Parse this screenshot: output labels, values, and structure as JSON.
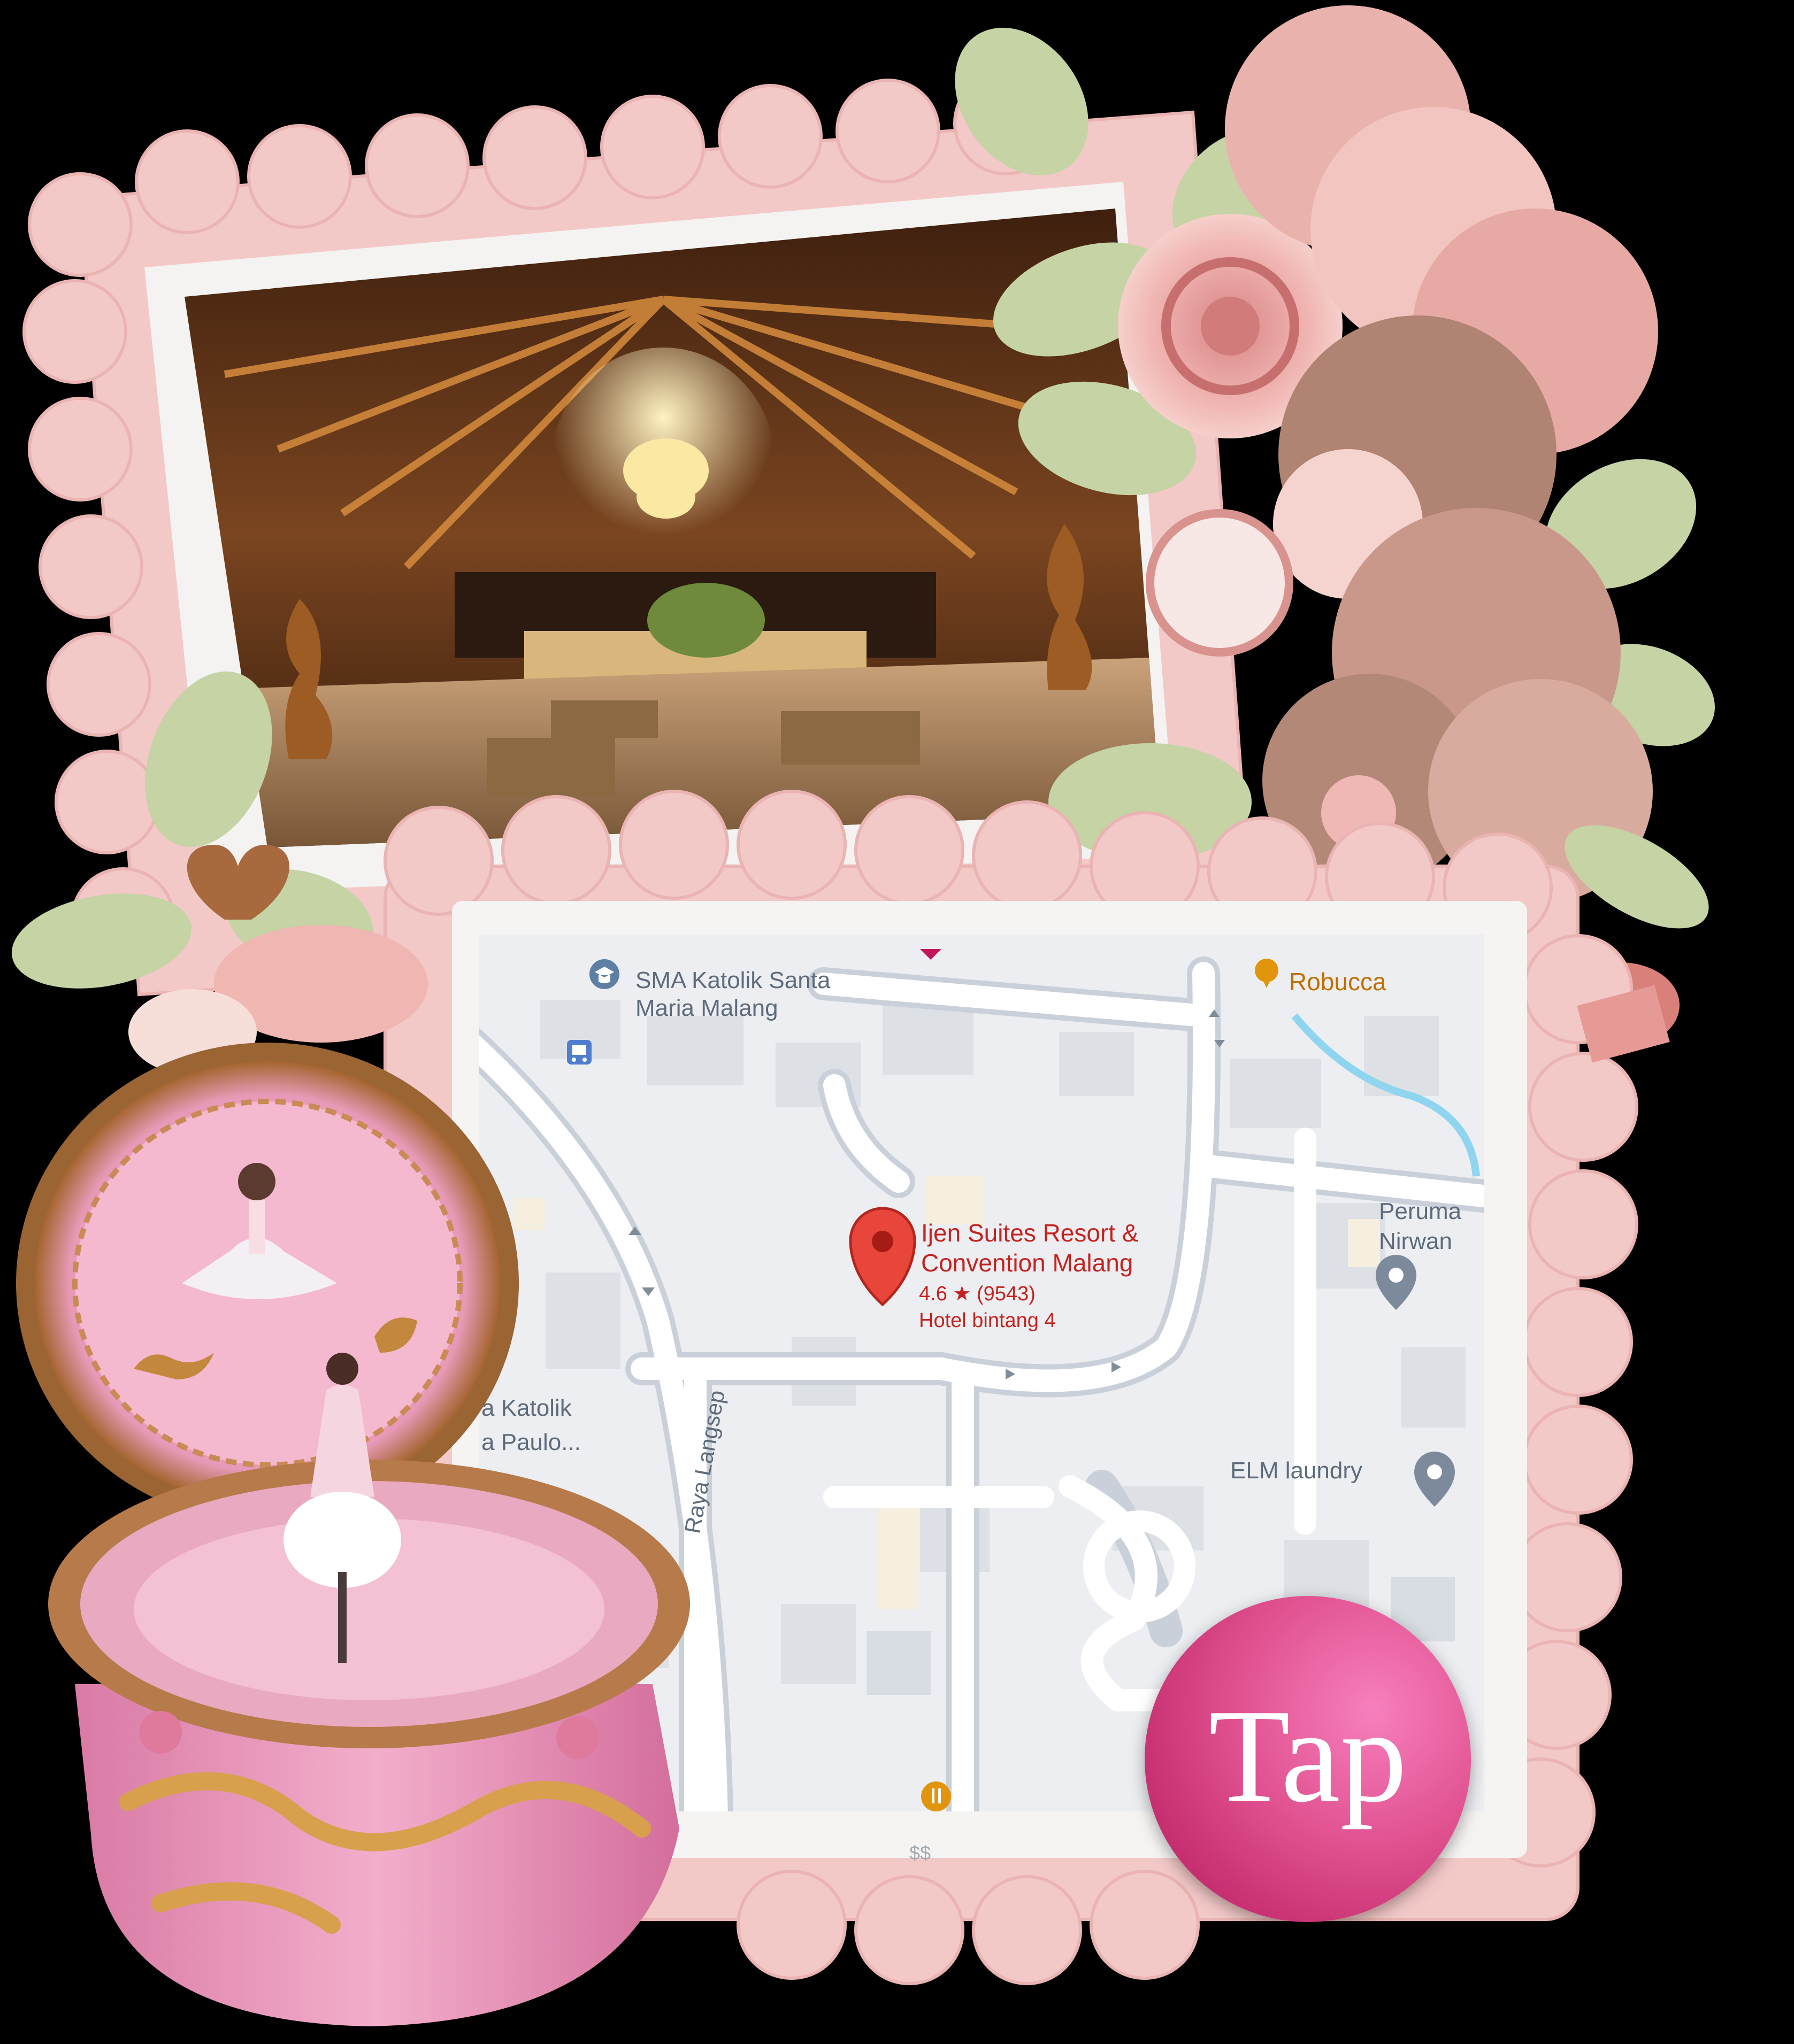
{
  "map": {
    "pois": {
      "school_top": "SMA Katolik Santa\nMaria Malang",
      "school_left_line1": "a Katolik",
      "school_left_line2": "a Paulo...",
      "cafe": "Robucca",
      "housing_line1": "Peruma",
      "housing_line2": "Nirwan",
      "laundry": "ELM laundry"
    },
    "street": "Raya Langsep",
    "place": {
      "name_line1": "Ijen Suites Resort &",
      "name_line2": "Convention Malang",
      "rating": "4.6 ★ (9543)",
      "category": "Hotel bintang 4"
    },
    "footer_partial": "$$"
  },
  "tap_button": {
    "label": "Tap"
  },
  "colors": {
    "frame": "#f3c9c8",
    "frame_edge": "#e8a9a8",
    "accent": "#e0508f",
    "map_bg": "#eceef1",
    "map_road": "#ffffff",
    "pin": "#e8463a"
  },
  "icons": [
    "school-icon",
    "bus-icon",
    "cafe-icon",
    "location-pin-icon",
    "place-icon",
    "restaurant-icon",
    "flower-bouquet-icon",
    "music-box-icon"
  ]
}
